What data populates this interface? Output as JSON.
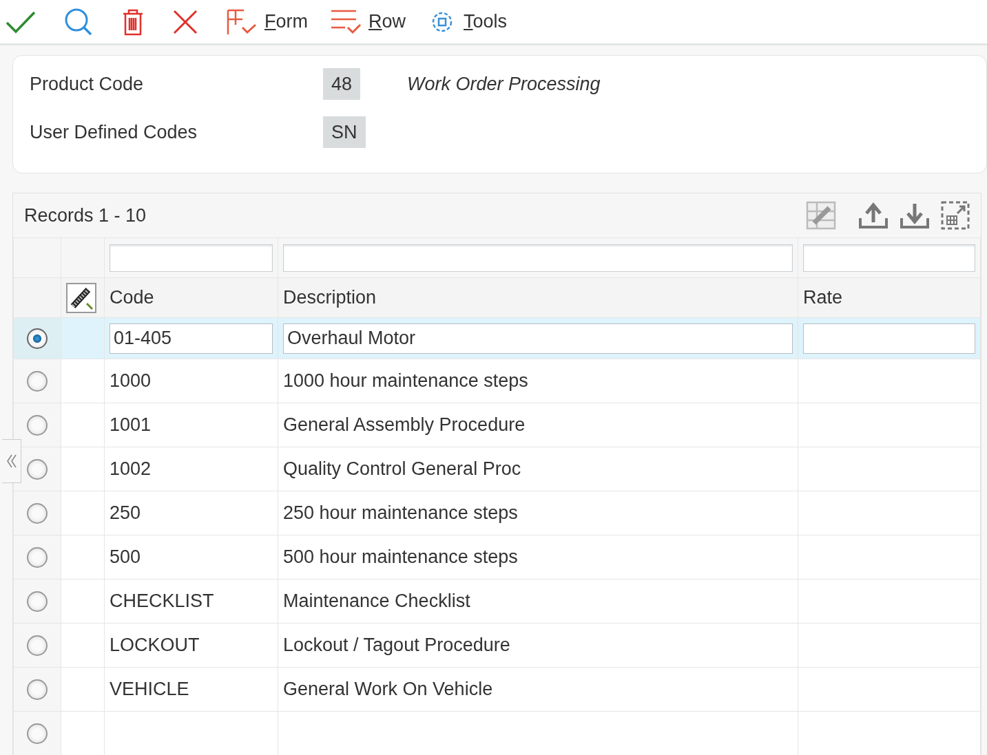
{
  "toolbar": {
    "menus": [
      {
        "kind": "form",
        "label": "Form"
      },
      {
        "kind": "row",
        "label": "Row"
      },
      {
        "kind": "tools",
        "label": "Tools"
      }
    ]
  },
  "header": {
    "fields": [
      {
        "label": "Product Code",
        "value": "48",
        "description": "Work Order Processing"
      },
      {
        "label": "User Defined Codes",
        "value": "SN"
      }
    ]
  },
  "grid": {
    "records": "Records 1 - 10",
    "columns": [
      "Code",
      "Description",
      "Rate"
    ],
    "rows": [
      {
        "selected": true,
        "code": "01-405",
        "description": "Overhaul Motor"
      },
      {
        "selected": false,
        "code": "1000",
        "description": "1000 hour maintenance steps"
      },
      {
        "selected": false,
        "code": "1001",
        "description": "General Assembly Procedure"
      },
      {
        "selected": false,
        "code": "1002",
        "description": "Quality Control General Proc"
      },
      {
        "selected": false,
        "code": "250",
        "description": "250 hour maintenance steps"
      },
      {
        "selected": false,
        "code": "500",
        "description": "500 hour maintenance steps"
      },
      {
        "selected": false,
        "code": "CHECKLIST",
        "description": "Maintenance Checklist"
      },
      {
        "selected": false,
        "code": "LOCKOUT",
        "description": "Lockout / Tagout Procedure"
      },
      {
        "selected": false,
        "code": "VEHICLE",
        "description": "General Work On Vehicle"
      },
      {
        "selected": false
      }
    ]
  }
}
